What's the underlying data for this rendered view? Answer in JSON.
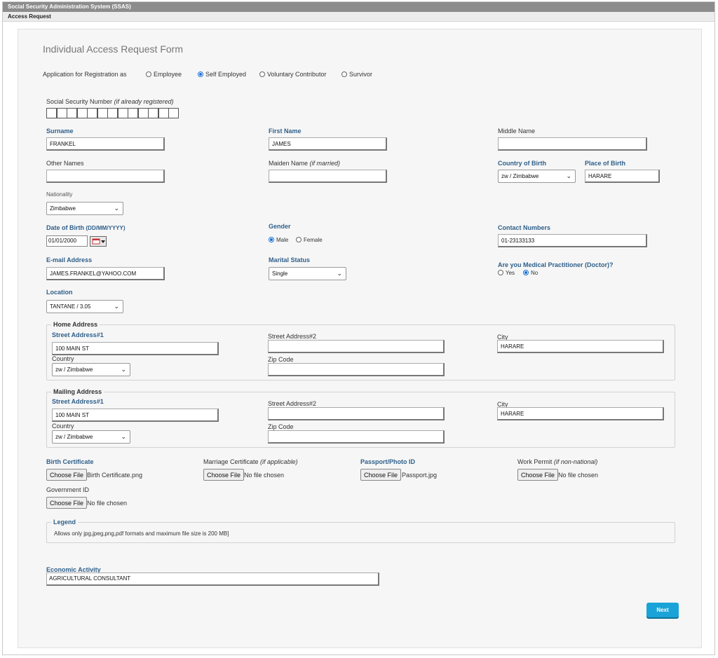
{
  "app": {
    "title": "Social Security Administration System (SSAS)",
    "section": "Access Request"
  },
  "form": {
    "title": "Individual Access Request Form",
    "registration": {
      "label": "Application for Registration as",
      "options": [
        "Employee",
        "Self Employed",
        "Voluntary Contributor",
        "Survivor"
      ],
      "selected": "Self Employed"
    },
    "ssn": {
      "label": "Social Security Number",
      "hint": "(if already registered)",
      "boxes": 13
    },
    "surname": {
      "label": "Surname",
      "value": "FRANKEL"
    },
    "first_name": {
      "label": "First Name",
      "value": "JAMES"
    },
    "middle_name": {
      "label": "Middle Name",
      "value": ""
    },
    "other_names": {
      "label": "Other Names",
      "value": ""
    },
    "maiden_name": {
      "label": "Maiden Name",
      "hint": "(if married)",
      "value": ""
    },
    "country_of_birth": {
      "label": "Country of Birth",
      "value": "zw / Zimbabwe"
    },
    "place_of_birth": {
      "label": "Place of Birth",
      "value": "HARARE"
    },
    "nationality": {
      "label": "Nationality",
      "value": "Zimbabwe"
    },
    "dob": {
      "label": "Date of Birth",
      "format": "(DD/MM/YYYY)",
      "value": "01/01/2000"
    },
    "gender": {
      "label": "Gender",
      "options": [
        "Male",
        "Female"
      ],
      "selected": "Male"
    },
    "contact": {
      "label": "Contact Numbers",
      "value": "01-23133133"
    },
    "email": {
      "label": "E-mail Address",
      "value": "JAMES.FRANKEL@YAHOO.COM"
    },
    "marital": {
      "label": "Marital Status",
      "value": "Single"
    },
    "medical": {
      "label": "Are you Medical Practitioner (Doctor)?",
      "options": [
        "Yes",
        "No"
      ],
      "selected": "No"
    },
    "location": {
      "label": "Location",
      "value": "TANTANE / 3.05"
    },
    "home_address": {
      "legend": "Home Address",
      "street1_label": "Street Address#1",
      "street1": "100 MAIN ST",
      "street2_label": "Street Address#2",
      "street2": "",
      "city_label": "City",
      "city": "HARARE",
      "country_label": "Country",
      "country": "zw / Zimbabwe",
      "zip_label": "Zip Code",
      "zip": ""
    },
    "mailing_address": {
      "legend": "Mailing Address",
      "street1_label": "Street Address#1",
      "street1": "100 MAIN ST",
      "street2_label": "Street Address#2",
      "street2": "",
      "city_label": "City",
      "city": "HARARE",
      "country_label": "Country",
      "country": "zw / Zimbabwe",
      "zip_label": "Zip Code",
      "zip": ""
    },
    "files": {
      "button_label": "Choose File",
      "birth_certificate": {
        "label": "Birth Certificate",
        "file": "Birth Certificate.png"
      },
      "marriage_certificate": {
        "label": "Marriage Certificate",
        "hint": "(if applicable)",
        "file": "No file chosen"
      },
      "passport": {
        "label": "Passport/Photo ID",
        "file": "Passport.jpg"
      },
      "work_permit": {
        "label": "Work Permit",
        "hint": "(if non-national)",
        "file": "No file chosen"
      },
      "government_id": {
        "label": "Government ID",
        "file": "No file chosen"
      }
    },
    "legend_box": {
      "title": "Legend",
      "text": "Allows only jpg,jpeg,png,pdf formats and maximum file size is 200 MB]"
    },
    "economic_activity": {
      "label": "Economic Activity",
      "value": "AGRICULTURAL CONSULTANT"
    },
    "next_label": "Next"
  },
  "colors": {
    "label_blue": "#2e5f8a",
    "titlebar": "#8c8c8c",
    "next_button": "#1aa3d8",
    "radio_selected": "#1a6fd6"
  },
  "icons": [
    "chevron-down-icon",
    "calendar-icon"
  ]
}
